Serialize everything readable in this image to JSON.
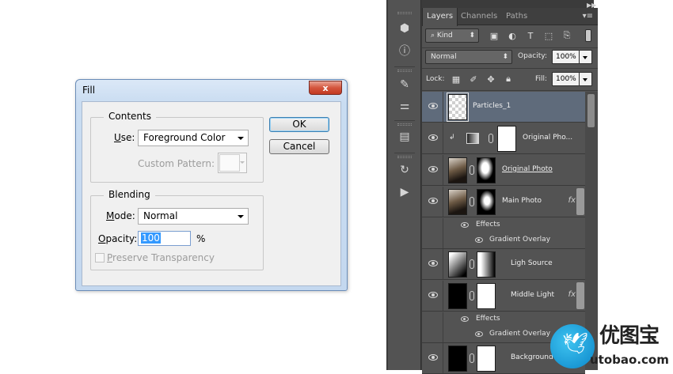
{
  "fill_dialog": {
    "title": "Fill",
    "close_glyph": "x",
    "contents": {
      "group_title": "Contents",
      "use_label_prefix": "U",
      "use_label_rest": "se:",
      "use_value": "Foreground Color",
      "custom_pattern_label": "Custom Pattern:"
    },
    "blending": {
      "group_title": "Blending",
      "mode_label_prefix": "M",
      "mode_label_rest": "ode:",
      "mode_value": "Normal",
      "opacity_label_prefix": "O",
      "opacity_label_rest": "pacity:",
      "opacity_value": "100",
      "opacity_unit": "%",
      "preserve_prefix": "P",
      "preserve_rest": "reserve Transparency"
    },
    "buttons": {
      "ok": "OK",
      "cancel": "Cancel"
    }
  },
  "panel": {
    "collapse_left_glyph": "◀◀",
    "collapse_right_glyph": "▶▶",
    "tabs": [
      {
        "label": "Layers",
        "active": true
      },
      {
        "label": "Channels",
        "active": false
      },
      {
        "label": "Paths",
        "active": false
      }
    ],
    "menu_glyph": "▾≡",
    "filter": {
      "kind_label": "Kind",
      "search_glyph": "⌕"
    },
    "blend_mode": "Normal",
    "opacity_label": "Opacity:",
    "opacity_value": "100%",
    "lock_label": "Lock:",
    "fill_label": "Fill:",
    "fill_value": "100%",
    "layers": [
      {
        "name": "Particles_1",
        "selected": true
      },
      {
        "name": "Original Pho..."
      },
      {
        "name": "Original Photo"
      },
      {
        "name": "Main Photo",
        "fx": "fx",
        "effects_label": "Effects",
        "effect_item": "Gradient Overlay"
      },
      {
        "name": "Ligh Source"
      },
      {
        "name": "Middle Light",
        "fx": "fx",
        "effects_label": "Effects",
        "effect_item": "Gradient Overlay"
      },
      {
        "name": "Background Co..."
      }
    ]
  },
  "watermark": {
    "cn_text": "优图宝",
    "url_text": "utobao.com",
    "circle_color": "#1aa3e0"
  }
}
